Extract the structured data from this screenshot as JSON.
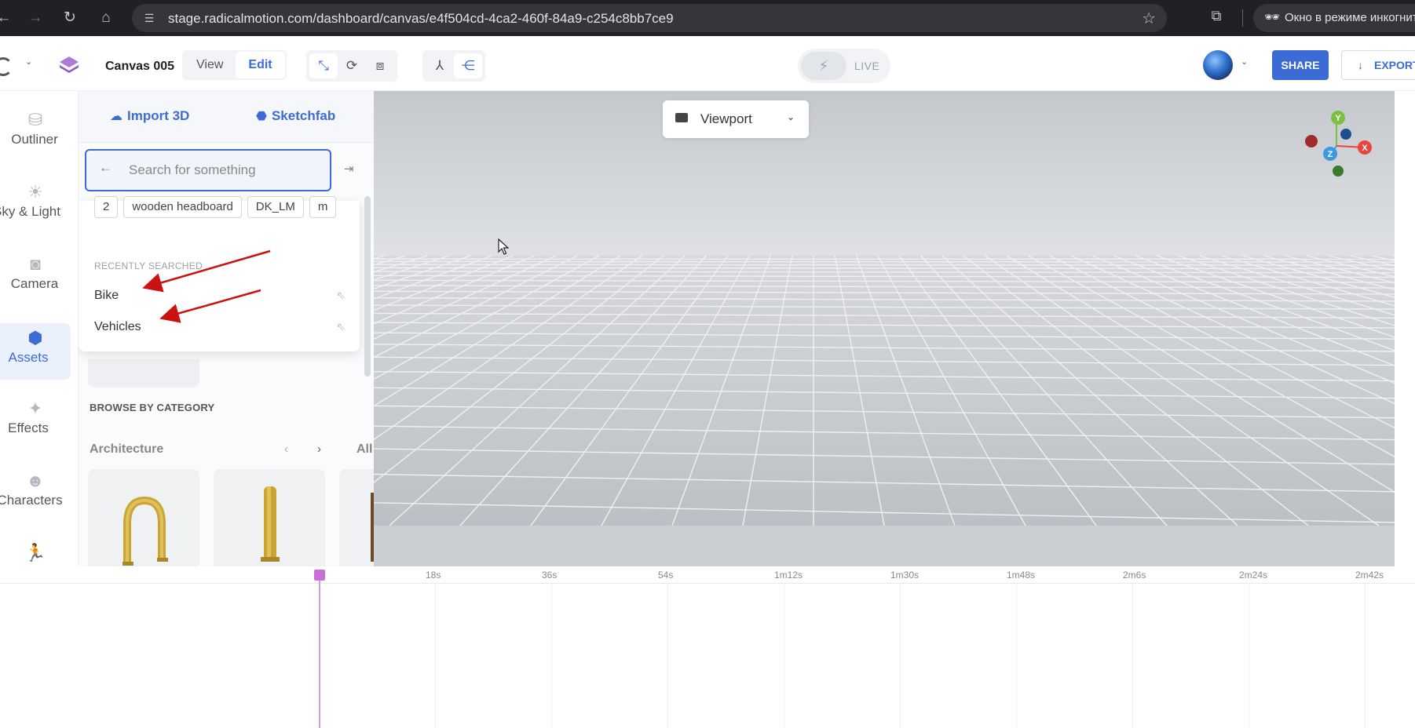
{
  "browser": {
    "url": "stage.radicalmotion.com/dashboard/canvas/e4f504cd-4ca2-460f-84a9-c254c8bb7ce9",
    "incognito_label": "Окно в режиме инкогнито"
  },
  "header": {
    "canvas_name": "Canvas 005",
    "mode_tabs": [
      "View",
      "Edit"
    ],
    "active_mode": "Edit",
    "live_label": "LIVE",
    "share_label": "SHARE",
    "export_label": "EXPORT"
  },
  "rail": {
    "items": [
      {
        "label": "Outliner",
        "icon": "database-icon"
      },
      {
        "label": "Sky & Light",
        "icon": "sun-icon"
      },
      {
        "label": "Camera",
        "icon": "camera-icon"
      },
      {
        "label": "Assets",
        "icon": "cube-icon",
        "active": true
      },
      {
        "label": "Effects",
        "icon": "sparkles-icon"
      },
      {
        "label": "Characters",
        "icon": "mask-icon"
      }
    ]
  },
  "panel": {
    "import_label": "Import 3D",
    "sketchfab_label": "Sketchfab",
    "search_placeholder": "Search for something",
    "chips": [
      "2",
      "wooden headboard",
      "DK_LM",
      "m"
    ],
    "recent_title": "RECENTLY SEARCHED",
    "recent": [
      "Bike",
      "Vehicles"
    ],
    "browse_title": "BROWSE BY CATEGORY",
    "category": "Architecture",
    "all_label": "All"
  },
  "viewport": {
    "camera_select": "Viewport",
    "axes": [
      "Y",
      "X",
      "Z"
    ]
  },
  "timeline": {
    "ticks": [
      "18s",
      "36s",
      "54s",
      "1m12s",
      "1m30s",
      "1m48s",
      "2m6s",
      "2m24s",
      "2m42s"
    ]
  },
  "colors": {
    "accent": "#3d6bd6",
    "playhead": "#c86fd8",
    "annotation_arrow": "#cc1111"
  }
}
